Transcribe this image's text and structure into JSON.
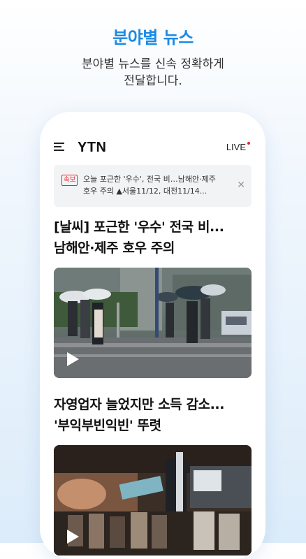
{
  "promo": {
    "title": "분야별 뉴스",
    "subtitle": "분야별 뉴스를 신속 정확하게\n전달합니다."
  },
  "app": {
    "logo": "YTN",
    "live_label": "LIVE",
    "icons": {
      "menu": "menu-icon",
      "close": "close-icon",
      "play": "play-icon"
    },
    "colors": {
      "accent": "#1a8ae5",
      "breaking_red": "#e8262e",
      "breaking_bg": "#f2f3f5"
    }
  },
  "breaking": {
    "badge": "속보",
    "text": "오늘 포근한 '우수', 전국 비…남해안·제주\n호우 주의 ▲서울11/12, 대전11/14..."
  },
  "articles": [
    {
      "title": "[날씨] 포근한 '우수' 전국 비...\n남해안·제주 호우 주의"
    },
    {
      "title": "자영업자 늘었지만 소득 감소...\n'부익부빈익빈' 뚜렷"
    }
  ]
}
